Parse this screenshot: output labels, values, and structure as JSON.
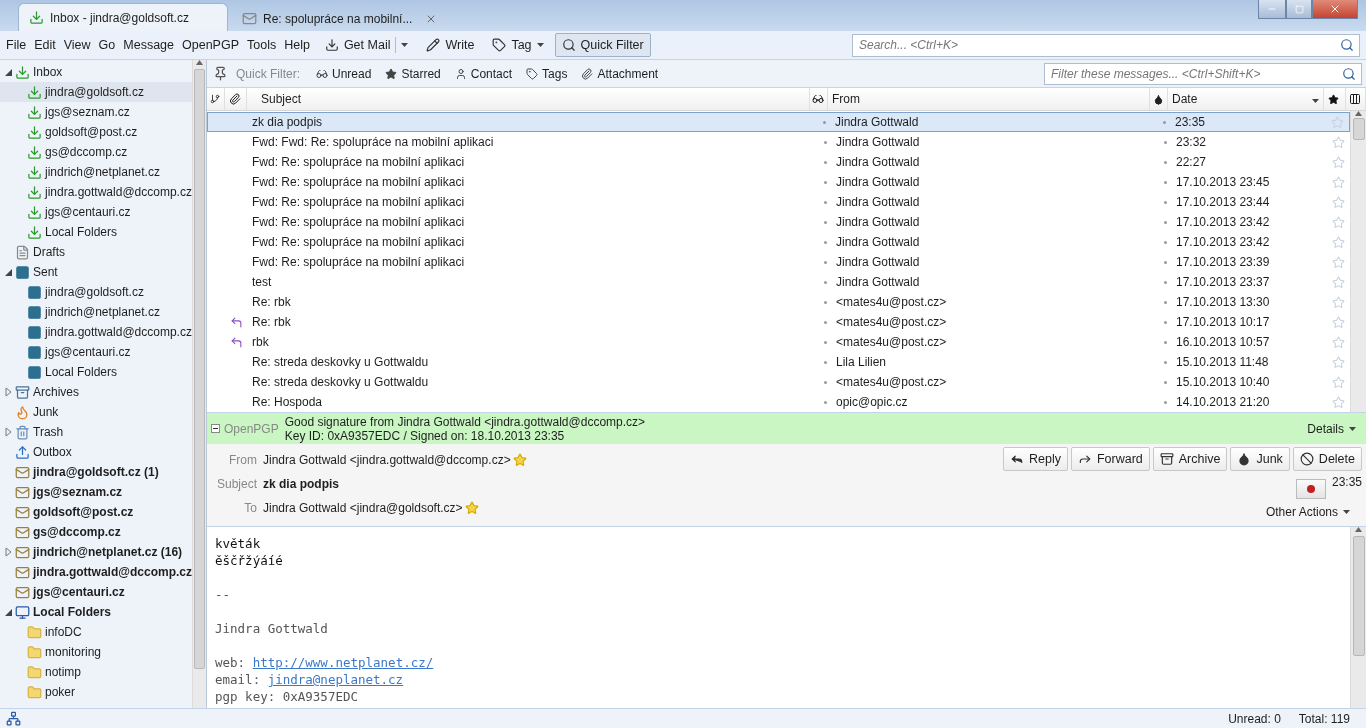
{
  "tabs": [
    {
      "label": "Inbox - jindra@goldsoft.cz",
      "kind": "inbox",
      "selected": true,
      "closable": false
    },
    {
      "label": "Re: spolupráce na mobilní...",
      "kind": "message",
      "selected": false,
      "closable": true
    }
  ],
  "menu": [
    "File",
    "Edit",
    "View",
    "Go",
    "Message",
    "OpenPGP",
    "Tools",
    "Help"
  ],
  "toolbar": [
    {
      "label": "Get Mail",
      "kind": "getmail",
      "dropdown": true,
      "split": true,
      "selected": false
    },
    {
      "label": "Write",
      "kind": "write",
      "dropdown": false,
      "split": false,
      "selected": false
    },
    {
      "label": "Tag",
      "kind": "tag",
      "dropdown": true,
      "split": false,
      "selected": false
    },
    {
      "label": "Quick Filter",
      "kind": "filter",
      "dropdown": false,
      "split": false,
      "selected": true
    }
  ],
  "search": {
    "placeholder": "Search... <Ctrl+K>"
  },
  "folders": [
    {
      "label": "Inbox",
      "kind": "inbox",
      "bold": false,
      "selected": false,
      "expanded": true,
      "children": [
        {
          "label": "jindra@goldsoft.cz",
          "kind": "inbox",
          "bold": false,
          "selected": true
        },
        {
          "label": "jgs@seznam.cz",
          "kind": "inbox",
          "bold": false,
          "selected": false
        },
        {
          "label": "goldsoft@post.cz",
          "kind": "inbox",
          "bold": false,
          "selected": false
        },
        {
          "label": "gs@dccomp.cz",
          "kind": "inbox",
          "bold": false,
          "selected": false
        },
        {
          "label": "jindrich@netplanet.cz",
          "kind": "inbox",
          "bold": false,
          "selected": false
        },
        {
          "label": "jindra.gottwald@dccomp.cz",
          "kind": "inbox",
          "bold": false,
          "selected": false
        },
        {
          "label": "jgs@centauri.cz",
          "kind": "inbox",
          "bold": false,
          "selected": false
        },
        {
          "label": "Local Folders",
          "kind": "inbox",
          "bold": false,
          "selected": false
        }
      ]
    },
    {
      "label": "Drafts",
      "kind": "drafts",
      "bold": false,
      "selected": false
    },
    {
      "label": "Sent",
      "kind": "sent",
      "bold": false,
      "selected": false,
      "expanded": true,
      "children": [
        {
          "label": "jindra@goldsoft.cz",
          "kind": "sent",
          "bold": false,
          "selected": false
        },
        {
          "label": "jindrich@netplanet.cz",
          "kind": "sent",
          "bold": false,
          "selected": false
        },
        {
          "label": "jindra.gottwald@dccomp.cz",
          "kind": "sent",
          "bold": false,
          "selected": false
        },
        {
          "label": "jgs@centauri.cz",
          "kind": "sent",
          "bold": false,
          "selected": false
        },
        {
          "label": "Local Folders",
          "kind": "sent",
          "bold": false,
          "selected": false
        }
      ]
    },
    {
      "label": "Archives",
      "kind": "archives",
      "bold": false,
      "selected": false,
      "expanded": false
    },
    {
      "label": "Junk",
      "kind": "junk",
      "bold": false,
      "selected": false
    },
    {
      "label": "Trash",
      "kind": "trash",
      "bold": false,
      "selected": false,
      "expanded": false
    },
    {
      "label": "Outbox",
      "kind": "outbox",
      "bold": false,
      "selected": false
    },
    {
      "label": "jindra@goldsoft.cz (1)",
      "kind": "account",
      "bold": true,
      "selected": false
    },
    {
      "label": "jgs@seznam.cz",
      "kind": "account",
      "bold": true,
      "selected": false
    },
    {
      "label": "goldsoft@post.cz",
      "kind": "account",
      "bold": true,
      "selected": false
    },
    {
      "label": "gs@dccomp.cz",
      "kind": "account",
      "bold": true,
      "selected": false
    },
    {
      "label": "jindrich@netplanet.cz (16)",
      "kind": "account",
      "bold": true,
      "selected": false,
      "expanded": false
    },
    {
      "label": "jindra.gottwald@dccomp.cz",
      "kind": "account",
      "bold": true,
      "selected": false
    },
    {
      "label": "jgs@centauri.cz",
      "kind": "account",
      "bold": true,
      "selected": false
    },
    {
      "label": "Local Folders",
      "kind": "local",
      "bold": true,
      "selected": false,
      "expanded": true,
      "children": [
        {
          "label": "infoDC",
          "kind": "folder",
          "bold": false,
          "selected": false
        },
        {
          "label": "monitoring",
          "kind": "folder",
          "bold": false,
          "selected": false
        },
        {
          "label": "notimp",
          "kind": "folder",
          "bold": false,
          "selected": false
        },
        {
          "label": "poker",
          "kind": "folder",
          "bold": false,
          "selected": false
        }
      ]
    }
  ],
  "quick_filter": {
    "label": "Quick Filter:",
    "buttons": [
      {
        "label": "Unread",
        "kind": "unread",
        "on": false
      },
      {
        "label": "Starred",
        "kind": "starred",
        "on": false
      },
      {
        "label": "Contact",
        "kind": "contact",
        "on": false
      },
      {
        "label": "Tags",
        "kind": "tags",
        "on": false
      },
      {
        "label": "Attachment",
        "kind": "attachment",
        "on": false
      }
    ],
    "placeholder": "Filter these messages... <Ctrl+Shift+K>"
  },
  "columns": {
    "subject": "Subject",
    "from": "From",
    "date": "Date"
  },
  "messages": [
    {
      "subject": "zk dia podpis",
      "from": "Jindra Gottwald",
      "date": "23:35",
      "replied": false,
      "selected": true
    },
    {
      "subject": "Fwd: Fwd: Re: spolupráce na mobilní aplikaci",
      "from": "Jindra Gottwald",
      "date": "23:32",
      "replied": false,
      "selected": false
    },
    {
      "subject": "Fwd: Re: spolupráce na mobilní aplikaci",
      "from": "Jindra Gottwald",
      "date": "22:27",
      "replied": false,
      "selected": false
    },
    {
      "subject": "Fwd: Re: spolupráce na mobilní aplikaci",
      "from": "Jindra Gottwald",
      "date": "17.10.2013 23:45",
      "replied": false,
      "selected": false
    },
    {
      "subject": "Fwd: Re: spolupráce na mobilní aplikaci",
      "from": "Jindra Gottwald",
      "date": "17.10.2013 23:44",
      "replied": false,
      "selected": false
    },
    {
      "subject": "Fwd: Re: spolupráce na mobilní aplikaci",
      "from": "Jindra Gottwald",
      "date": "17.10.2013 23:42",
      "replied": false,
      "selected": false
    },
    {
      "subject": "Fwd: Re: spolupráce na mobilní aplikaci",
      "from": "Jindra Gottwald",
      "date": "17.10.2013 23:42",
      "replied": false,
      "selected": false
    },
    {
      "subject": "Fwd: Re: spolupráce na mobilní aplikaci",
      "from": "Jindra Gottwald",
      "date": "17.10.2013 23:39",
      "replied": false,
      "selected": false
    },
    {
      "subject": "test",
      "from": "Jindra Gottwald",
      "date": "17.10.2013 23:37",
      "replied": false,
      "selected": false
    },
    {
      "subject": "Re: rbk",
      "from": "<mates4u@post.cz>",
      "date": "17.10.2013 13:30",
      "replied": false,
      "selected": false
    },
    {
      "subject": "Re: rbk",
      "from": "<mates4u@post.cz>",
      "date": "17.10.2013 10:17",
      "replied": true,
      "selected": false
    },
    {
      "subject": "rbk",
      "from": "<mates4u@post.cz>",
      "date": "16.10.2013 10:57",
      "replied": true,
      "selected": false
    },
    {
      "subject": "Re: streda deskovky u Gottwaldu",
      "from": "Lila Lilien",
      "date": "15.10.2013 11:48",
      "replied": false,
      "selected": false
    },
    {
      "subject": "Re: streda deskovky u Gottwaldu",
      "from": "<mates4u@post.cz>",
      "date": "15.10.2013 10:40",
      "replied": false,
      "selected": false
    },
    {
      "subject": "Re: Hospoda",
      "from": "opic@opic.cz",
      "date": "14.10.2013 21:20",
      "replied": false,
      "selected": false
    }
  ],
  "signature": {
    "label": "OpenPGP",
    "expanded": true,
    "lines": [
      "Good signature from Jindra Gottwald <jindra.gottwald@dccomp.cz>",
      "Key ID: 0xA9357EDC / Signed on: 18.10.2013 23:35"
    ],
    "details": "Details"
  },
  "header": {
    "fields": [
      {
        "label": "From",
        "value": "Jindra Gottwald <jindra.gottwald@dccomp.cz>",
        "kind": "contact",
        "starred": true
      },
      {
        "label": "Subject",
        "value": "zk dia podpis",
        "kind": "subject"
      },
      {
        "label": "To",
        "value": "Jindra Gottwald <jindra@goldsoft.cz>",
        "kind": "contact",
        "starred": true
      }
    ],
    "actions": [
      {
        "label": "Reply",
        "kind": "reply"
      },
      {
        "label": "Forward",
        "kind": "forward"
      },
      {
        "label": "Archive",
        "kind": "archive"
      },
      {
        "label": "Junk",
        "kind": "junk"
      },
      {
        "label": "Delete",
        "kind": "delete"
      }
    ],
    "time": "23:35",
    "other": "Other Actions"
  },
  "body": [
    {
      "text": "květák",
      "kind": "text"
    },
    {
      "text": "ěščřžýáíé",
      "kind": "text"
    },
    {
      "kind": "blank"
    },
    {
      "text": "--",
      "kind": "sig"
    },
    {
      "kind": "blank"
    },
    {
      "text": "Jindra Gottwald",
      "kind": "sig"
    },
    {
      "kind": "blank"
    },
    {
      "label": "web:",
      "text": "http://www.netplanet.cz/",
      "kind": "link"
    },
    {
      "label": "email:",
      "text": "jindra@neplanet.cz",
      "kind": "link"
    },
    {
      "text": "pgp key: 0xA9357EDC",
      "kind": "sig"
    }
  ],
  "status_bar": {
    "unread": "Unread: 0",
    "total": "Total: 119"
  }
}
